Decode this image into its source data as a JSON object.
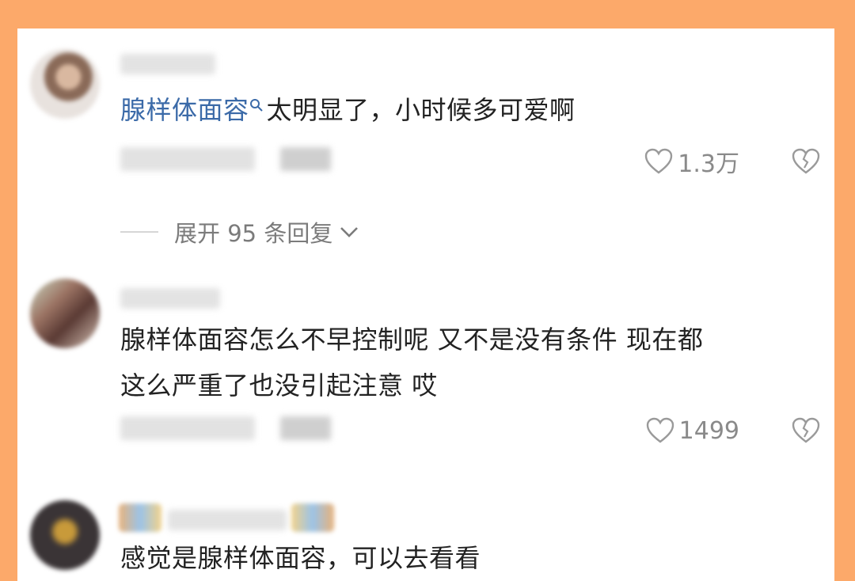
{
  "comments": [
    {
      "highlight": "腺样体面容",
      "text": "太明显了，小时候多可爱啊",
      "likes": "1.3万",
      "replies_label": "展开 95 条回复"
    },
    {
      "text_line1": "腺样体面容怎么不早控制呢 又不是没有条件 现在都",
      "text_line2": "这么严重了也没引起注意 哎",
      "likes": "1499"
    },
    {
      "text": "感觉是腺样体面容，可以去看看"
    }
  ],
  "icons": {
    "like": "heart-outline-icon",
    "dislike": "broken-heart-icon",
    "search_hint": "search-icon",
    "expand": "chevron-down-icon"
  },
  "colors": {
    "frame": "#FCA96A",
    "highlight": "#3B6AA8",
    "meta": "#8a8a8a"
  }
}
